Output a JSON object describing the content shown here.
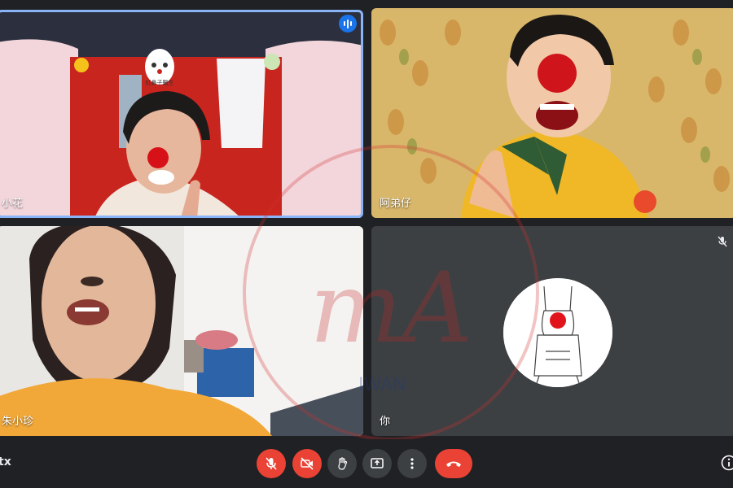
{
  "participants": [
    {
      "name": "小花",
      "speaking": true
    },
    {
      "name": "阿弟仔"
    },
    {
      "name": "朱小珍"
    },
    {
      "name": "你",
      "muted": true
    }
  ],
  "banner_text": "紅鼻子醫生",
  "meeting_code_text": "tx",
  "controls": [
    "mic-off",
    "camera-off",
    "raise-hand",
    "present",
    "more-options",
    "leave-call",
    "info"
  ],
  "watermark_text": "IWAN",
  "colors": {
    "background": "#202124",
    "tile": "#3c4043",
    "active_outline": "#8ab4f8",
    "danger": "#ea4335",
    "speaking_badge": "#1a73e8"
  }
}
